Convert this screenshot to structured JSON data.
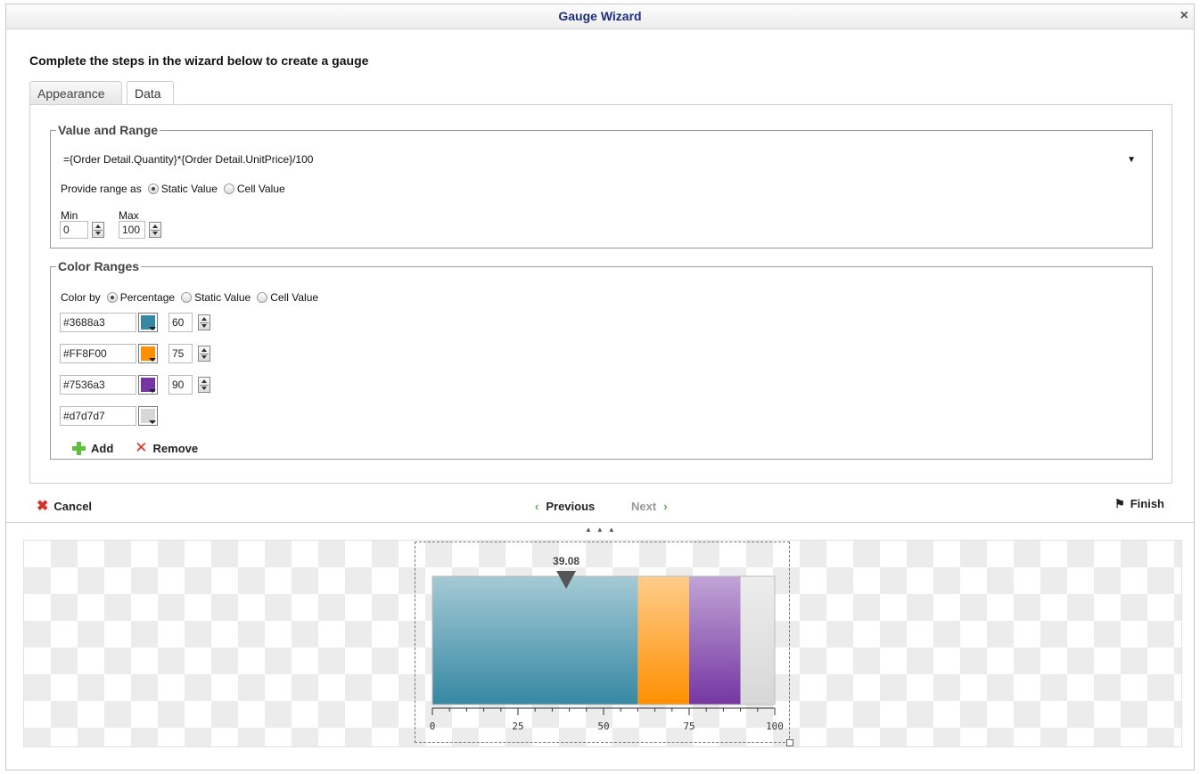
{
  "dialog": {
    "title": "Gauge Wizard",
    "close_label": "×"
  },
  "intro": "Complete the steps in the wizard below to create a gauge",
  "tabs": [
    {
      "label": "Appearance"
    },
    {
      "label": "Data",
      "active": true
    }
  ],
  "value_range": {
    "legend": "Value and Range",
    "expression": "={Order Detail.Quantity}*{Order Detail.UnitPrice}/100",
    "dropdown_icon": "▼",
    "provide_range_label": "Provide range as",
    "options": [
      "Static Value",
      "Cell Value"
    ],
    "selected": "Static Value",
    "min_label": "Min",
    "max_label": "Max",
    "min": "0",
    "max": "100"
  },
  "color_ranges": {
    "legend": "Color Ranges",
    "color_by_label": "Color by",
    "options": [
      "Percentage",
      "Static Value",
      "Cell Value"
    ],
    "selected": "Percentage",
    "rows": [
      {
        "hex": "#3688a3",
        "swatch": "#3688a3",
        "value": "60"
      },
      {
        "hex": "#FF8F00",
        "swatch": "#FF8F00",
        "value": "75"
      },
      {
        "hex": "#7536a3",
        "swatch": "#7536a3",
        "value": "90"
      },
      {
        "hex": "#d7d7d7",
        "swatch": "#d7d7d7",
        "value": ""
      }
    ],
    "add_label": "Add",
    "remove_label": "Remove"
  },
  "nav": {
    "cancel_label": "Cancel",
    "previous_label": "Previous",
    "next_label": "Next",
    "finish_label": "Finish",
    "next_enabled": false
  },
  "gauge": {
    "value_label": "39.08",
    "value": 39.08,
    "min": 0,
    "max": 100,
    "ticks": [
      "0",
      "25",
      "50",
      "75",
      "100"
    ],
    "bands": [
      {
        "from": 0,
        "to": 60,
        "color": "#3688a3"
      },
      {
        "from": 60,
        "to": 75,
        "color": "#FF8F00"
      },
      {
        "from": 75,
        "to": 90,
        "color": "#7536a3"
      },
      {
        "from": 90,
        "to": 100,
        "color": "#d7d7d7"
      }
    ]
  }
}
